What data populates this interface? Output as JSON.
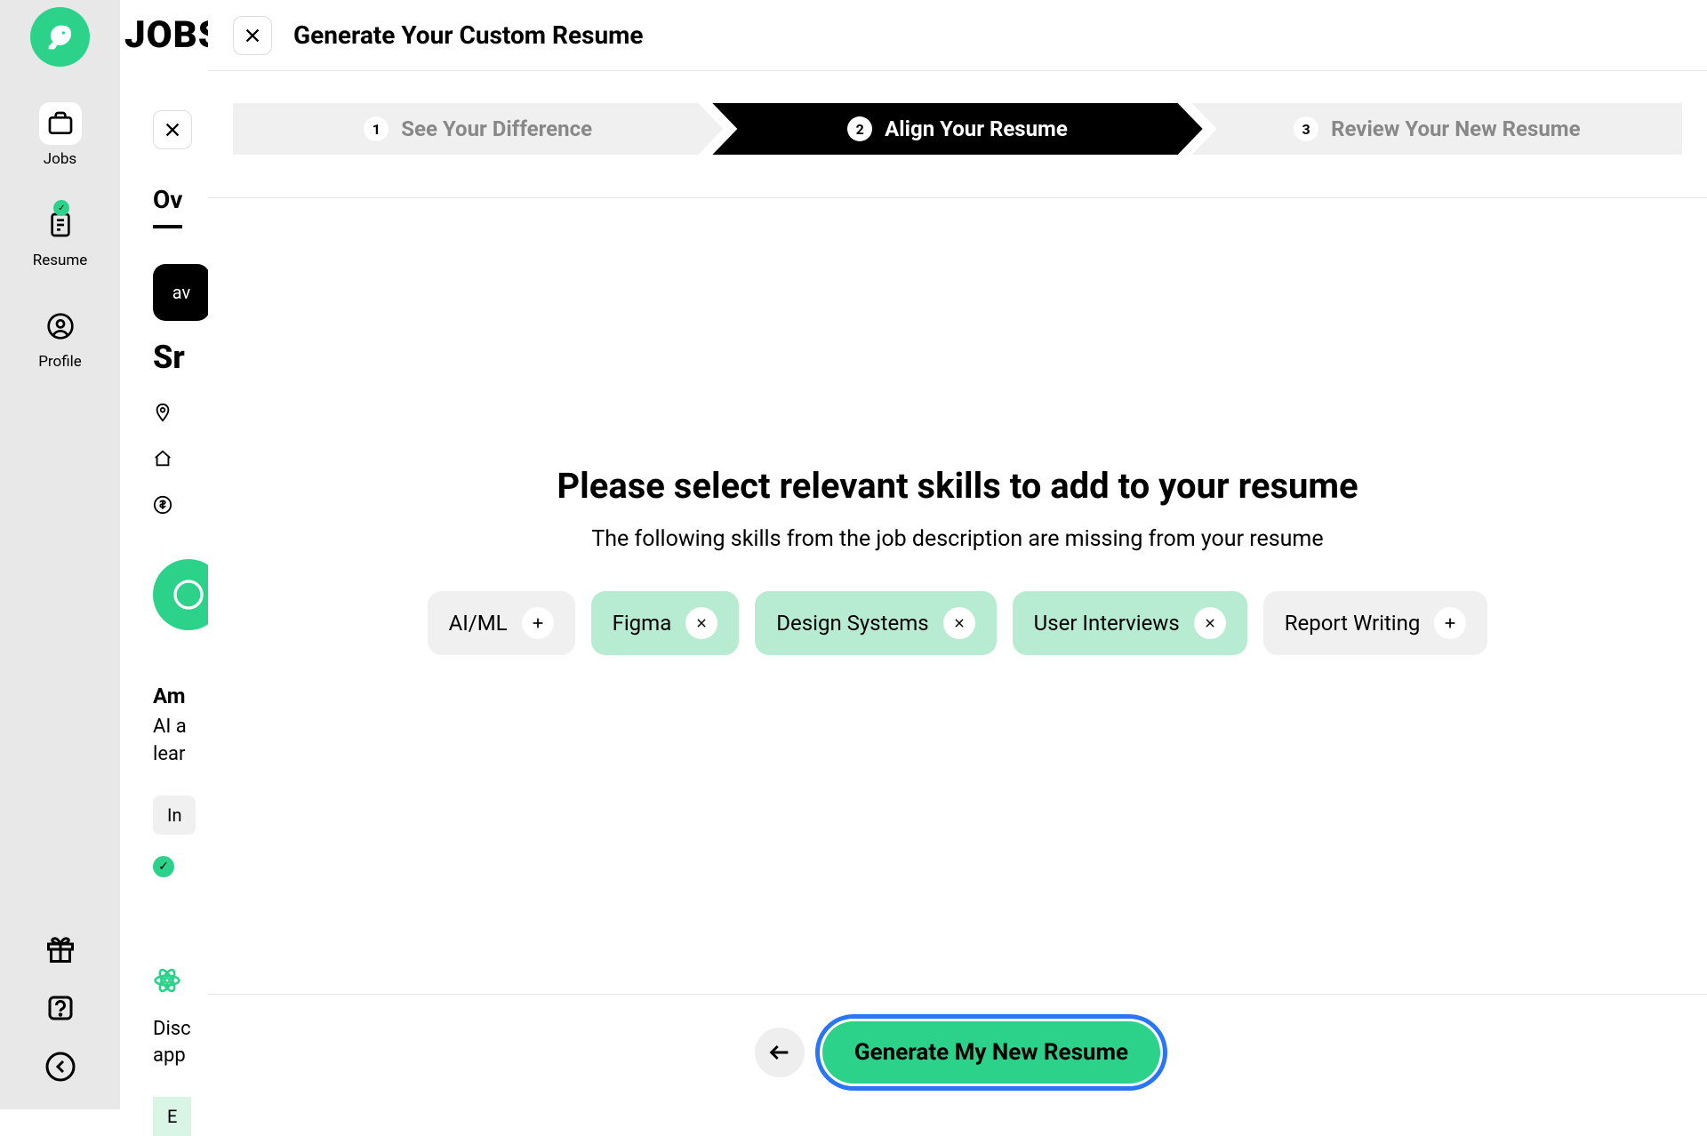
{
  "brand": {
    "header_text": "JOBS"
  },
  "nav": {
    "items": [
      {
        "label": "Jobs",
        "active": true
      },
      {
        "label": "Resume",
        "has_badge": true
      },
      {
        "label": "Profile"
      }
    ]
  },
  "panel": {
    "tab_label": "Ov",
    "company_code": "av",
    "title_prefix": "Sr",
    "company_name": "Am",
    "desc_line1": "AI a",
    "desc_line2": "lear",
    "tag_prefix": "In",
    "disc_line1": "Disc",
    "disc_line2": "app",
    "e_tag": "E"
  },
  "modal": {
    "title": "Generate Your Custom Resume",
    "steps": [
      {
        "num": "1",
        "label": "See Your Difference"
      },
      {
        "num": "2",
        "label": "Align Your Resume",
        "active": true
      },
      {
        "num": "3",
        "label": "Review Your New Resume"
      }
    ],
    "content_title": "Please select relevant skills to add to your resume",
    "content_subtitle": "The following skills from the job description are missing from your resume",
    "skills": [
      {
        "name": "AI/ML",
        "selected": false
      },
      {
        "name": "Figma",
        "selected": true
      },
      {
        "name": "Design Systems",
        "selected": true
      },
      {
        "name": "User Interviews",
        "selected": true
      },
      {
        "name": "Report Writing",
        "selected": false
      }
    ],
    "generate_label": "Generate My New Resume"
  }
}
